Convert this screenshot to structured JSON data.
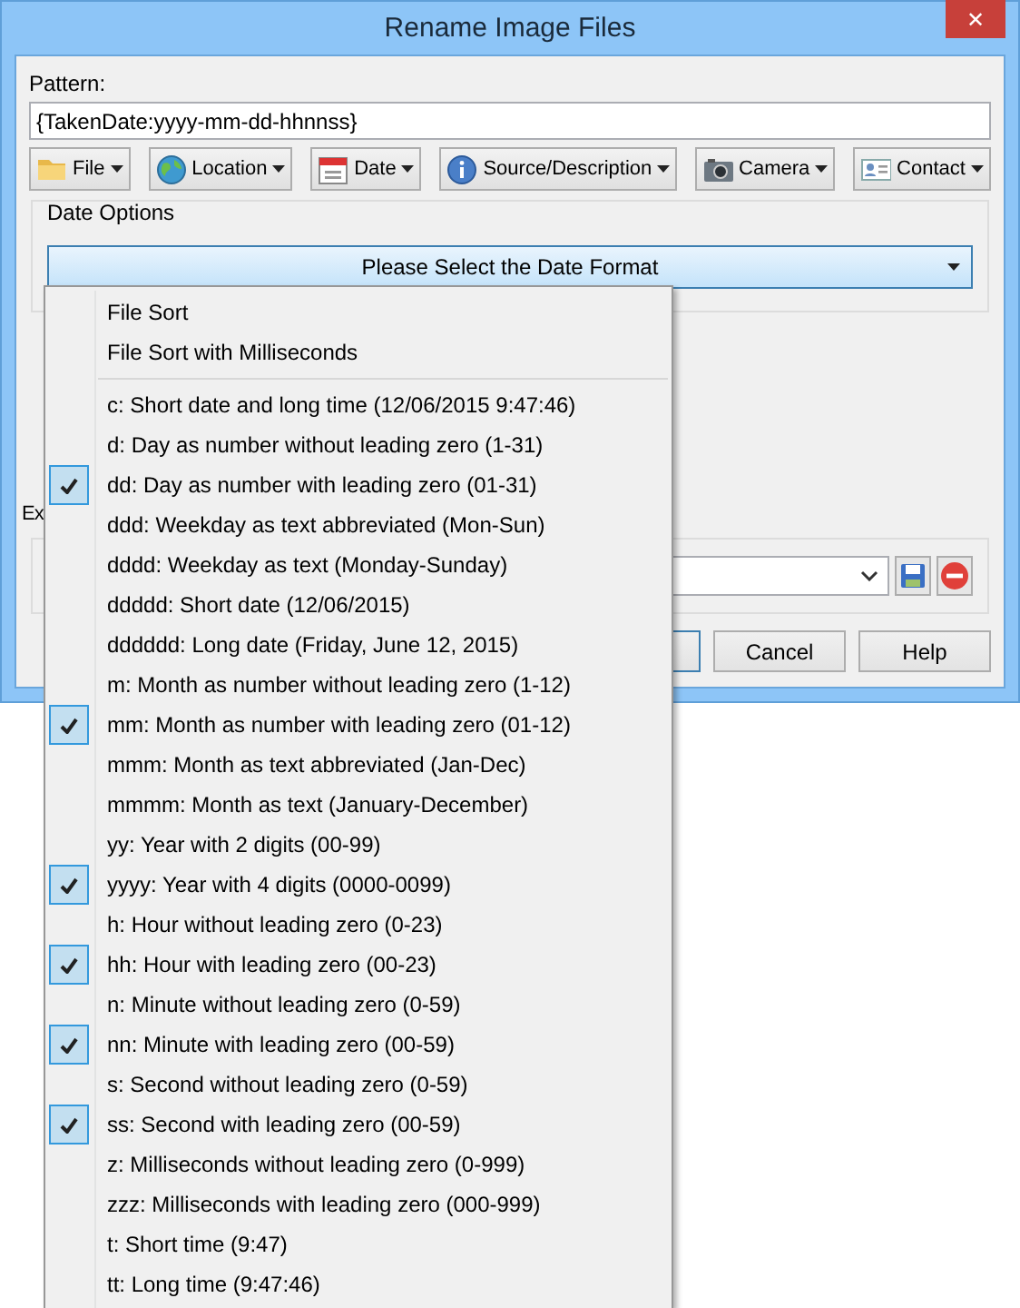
{
  "window": {
    "title": "Rename Image Files",
    "close": "✕"
  },
  "pattern": {
    "label": "Pattern:",
    "value": "{TakenDate:yyyy-mm-dd-hhnnss}"
  },
  "toolbar": [
    {
      "label": "File",
      "kind": "folder"
    },
    {
      "label": "Location",
      "kind": "globe"
    },
    {
      "label": "Date",
      "kind": "calendar"
    },
    {
      "label": "Source/Description",
      "kind": "info"
    },
    {
      "label": "Camera",
      "kind": "camera"
    },
    {
      "label": "Contact",
      "kind": "card"
    }
  ],
  "date_options": {
    "title": "Date Options",
    "select": "Please Select the Date Format"
  },
  "label_partial": "Ex",
  "buttons": [
    {
      "label": "Cancel"
    },
    {
      "label": "Help"
    }
  ],
  "menu": {
    "sections": [
      {
        "items": [
          {
            "label": "File Sort",
            "checked": false
          },
          {
            "label": "File Sort with Milliseconds",
            "checked": false
          }
        ]
      },
      {
        "items": [
          {
            "label": "c: Short date and long time (12/06/2015 9:47:46)",
            "checked": false
          },
          {
            "label": "d: Day as number without leading zero (1-31)",
            "checked": false
          },
          {
            "label": "dd: Day as number with leading zero (01-31)",
            "checked": true
          },
          {
            "label": "ddd: Weekday as text abbreviated (Mon-Sun)",
            "checked": false
          },
          {
            "label": "dddd: Weekday as text (Monday-Sunday)",
            "checked": false
          },
          {
            "label": "ddddd: Short date (12/06/2015)",
            "checked": false
          },
          {
            "label": "dddddd: Long date (Friday, June 12, 2015)",
            "checked": false
          },
          {
            "label": "m: Month as number without leading zero (1-12)",
            "checked": false
          },
          {
            "label": "mm: Month as number with leading zero (01-12)",
            "checked": true
          },
          {
            "label": "mmm: Month as text abbreviated (Jan-Dec)",
            "checked": false
          },
          {
            "label": "mmmm: Month as text (January-December)",
            "checked": false
          },
          {
            "label": "yy: Year with 2 digits (00-99)",
            "checked": false
          },
          {
            "label": "yyyy: Year with 4 digits (0000-0099)",
            "checked": true
          },
          {
            "label": "h: Hour without leading zero (0-23)",
            "checked": false
          },
          {
            "label": "hh: Hour with leading zero (00-23)",
            "checked": true
          },
          {
            "label": "n: Minute without leading zero (0-59)",
            "checked": false
          },
          {
            "label": "nn: Minute with leading zero (00-59)",
            "checked": true
          },
          {
            "label": "s: Second without leading zero (0-59)",
            "checked": false
          },
          {
            "label": "ss: Second with leading zero (00-59)",
            "checked": true
          },
          {
            "label": "z: Milliseconds without leading zero (0-999)",
            "checked": false
          },
          {
            "label": "zzz: Milliseconds with leading zero (000-999)",
            "checked": false
          },
          {
            "label": "t: Short time (9:47)",
            "checked": false
          },
          {
            "label": "tt: Long time (9:47:46)",
            "checked": false
          }
        ]
      }
    ]
  }
}
